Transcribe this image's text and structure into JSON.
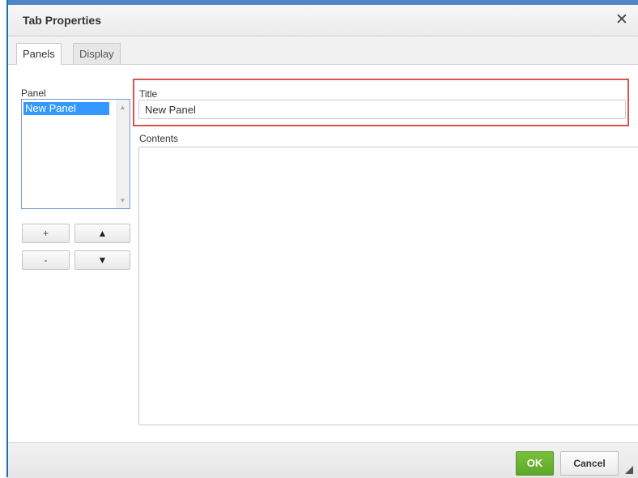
{
  "dialog": {
    "title": "Tab Properties",
    "close_glyph": "✕",
    "close_icon": "close-icon"
  },
  "tabs": [
    {
      "label": "Panels",
      "active": true
    },
    {
      "label": "Display",
      "active": false
    }
  ],
  "panels": {
    "list_label": "Panel",
    "items": [
      "New Panel"
    ],
    "selected": "New Panel",
    "add_label": "+",
    "remove_label": "-",
    "move_up_glyph": "▲",
    "move_down_glyph": "▼",
    "scroll_up_glyph": "▲",
    "scroll_down_glyph": "▼"
  },
  "editor": {
    "title_label": "Title",
    "title_value": "New Panel",
    "contents_label": "Contents",
    "contents_value": ""
  },
  "footer": {
    "ok_label": "OK",
    "cancel_label": "Cancel"
  },
  "colors": {
    "ok_green": "#6ab332",
    "highlight_red": "#d9534f",
    "selection_blue": "#3399ff",
    "accent_blue": "#1b6fb8"
  }
}
